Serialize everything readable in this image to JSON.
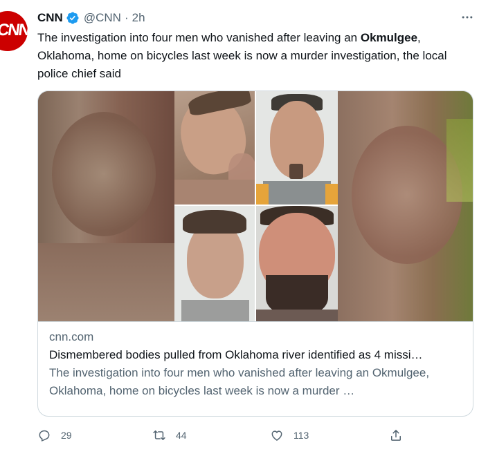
{
  "tweet": {
    "author_name": "CNN",
    "handle": "@CNN",
    "separator": "·",
    "time": "2h",
    "avatar_text": "CNN",
    "text_before": "The investigation into four men who vanished after leaving an ",
    "text_bold": "Okmulgee",
    "text_after": ", Oklahoma, home on bicycles last week is now a murder investigation, the local police chief said"
  },
  "card": {
    "domain": "cnn.com",
    "title": "Dismembered bodies pulled from Oklahoma river identified as 4 missi…",
    "description": "The investigation into four men who vanished after leaving an Okmulgee, Oklahoma, home on bicycles last week is now a murder …"
  },
  "actions": {
    "replies": "29",
    "retweets": "44",
    "likes": "113"
  },
  "colors": {
    "text": "#0f1419",
    "secondary": "#536471",
    "verified": "#1d9bf0",
    "brand": "#cc0000",
    "border": "#cfd9de"
  }
}
